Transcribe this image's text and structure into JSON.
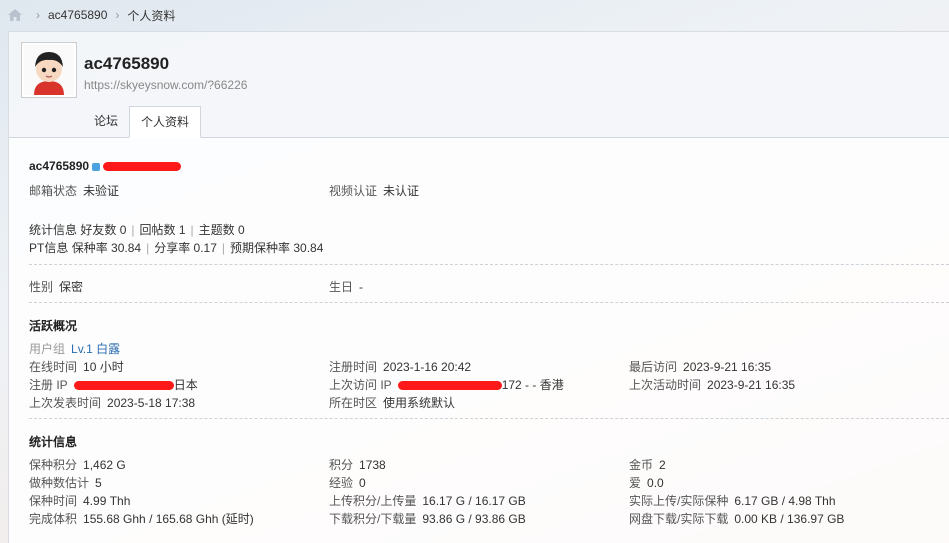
{
  "breadcrumb": {
    "user": "ac4765890",
    "current": "个人资料"
  },
  "profile": {
    "name": "ac4765890",
    "url": "https://skyeysnow.com/?66226"
  },
  "tabs": [
    "论坛",
    "个人资料"
  ],
  "info": {
    "name": "ac4765890",
    "email_label": "邮箱状态",
    "email_value": "未验证",
    "video_label": "视频认证",
    "video_value": "未认证"
  },
  "stats": {
    "label": "统计信息",
    "friends": "好友数 0",
    "replies": "回帖数 1",
    "threads": "主题数 0",
    "pt_label": "PT信息",
    "seed_rate": "保种率 30.84",
    "share_rate": "分享率 0.17",
    "expected": "预期保种率 30.84"
  },
  "gender": {
    "label": "性别",
    "value": "保密"
  },
  "birthday": {
    "label": "生日",
    "value": "-"
  },
  "activity": {
    "title": "活跃概况",
    "group_label": "用户组",
    "group_value": "Lv.1 白露",
    "online_label": "在线时间",
    "online_value": "10 小时",
    "reg_label": "注册时间",
    "reg_value": "2023-1-16 20:42",
    "last_visit_label": "最后访问",
    "last_visit_value": "2023-9-21 16:35",
    "reg_ip_label": "注册 IP",
    "reg_ip_suffix": "日本",
    "last_ip_label": "上次访问 IP",
    "last_ip_suffix": "172 - - 香港",
    "last_active_label": "上次活动时间",
    "last_active_value": "2023-9-21 16:35",
    "last_post_label": "上次发表时间",
    "last_post_value": "2023-5-18 17:38",
    "tz_label": "所在时区",
    "tz_value": "使用系统默认"
  },
  "statinfo": {
    "title": "统计信息",
    "seed_points_label": "保种积分",
    "seed_points_value": "1,462 G",
    "points_label": "积分",
    "points_value": "1738",
    "coins_label": "金币",
    "coins_value": "2",
    "est_label": "做种数估计",
    "est_value": "5",
    "exp_label": "经验",
    "exp_value": "0",
    "love_label": "爱",
    "love_value": "0.0",
    "seed_time_label": "保种时间",
    "seed_time_value": "4.99 Thh",
    "upload_label": "上传积分/上传量",
    "upload_value": "16.17 G / 16.17 GB",
    "real_up_label": "实际上传/实际保种",
    "real_up_value": "6.17 GB / 4.98 Thh",
    "volume_label": "完成体积",
    "volume_value": "155.68 Ghh / 165.68 Ghh (延时)",
    "download_label": "下载积分/下载量",
    "download_value": "93.86 G / 93.86 GB",
    "disk_label": "网盘下载/实际下载",
    "disk_value": "0.00 KB / 136.97 GB"
  },
  "colors": {
    "accent": "#2a6db0",
    "redaction": "#ff1a1a"
  }
}
